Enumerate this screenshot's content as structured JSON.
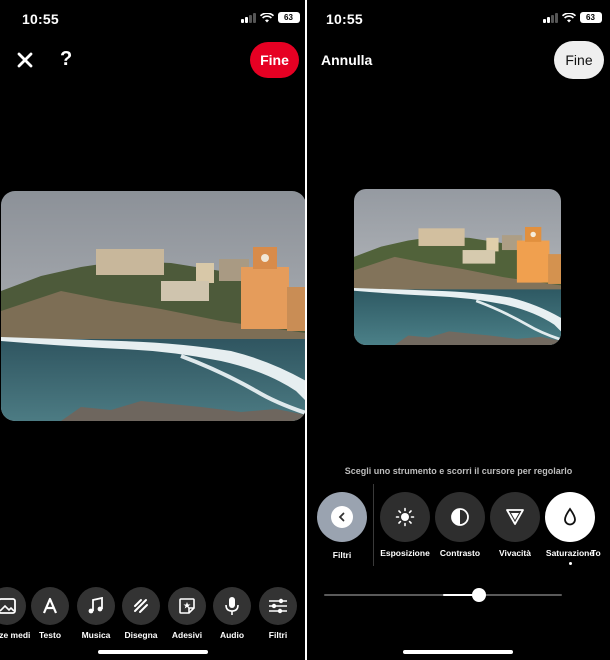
{
  "left": {
    "status": {
      "time": "10:55",
      "battery": "63"
    },
    "header": {
      "done_label": "Fine"
    },
    "toolbar": [
      {
        "label": "Bozze medi",
        "icon": "image-icon"
      },
      {
        "label": "Testo",
        "icon": "text-icon"
      },
      {
        "label": "Musica",
        "icon": "music-icon"
      },
      {
        "label": "Disegna",
        "icon": "draw-icon"
      },
      {
        "label": "Adesivi",
        "icon": "sticker-icon"
      },
      {
        "label": "Audio",
        "icon": "microphone-icon"
      },
      {
        "label": "Filtri",
        "icon": "sliders-icon"
      }
    ]
  },
  "right": {
    "status": {
      "time": "10:55",
      "battery": "63"
    },
    "header": {
      "cancel_label": "Annulla",
      "done_label": "Fine"
    },
    "hint": "Scegli uno strumento e scorri il cursore per regolarlo",
    "filters_label": "Filtri",
    "tools": [
      {
        "label": "Esposizione",
        "icon": "sun-icon",
        "active": false
      },
      {
        "label": "Contrasto",
        "icon": "contrast-icon",
        "active": false
      },
      {
        "label": "Vivacità",
        "icon": "triangle-icon",
        "active": false
      },
      {
        "label": "Saturazione",
        "icon": "drop-icon",
        "active": true
      },
      {
        "label": "To",
        "icon": "",
        "active": false
      }
    ],
    "slider": {
      "value": 0.65
    },
    "colors": {
      "accent_red": "#e60023",
      "background": "#000000"
    }
  }
}
